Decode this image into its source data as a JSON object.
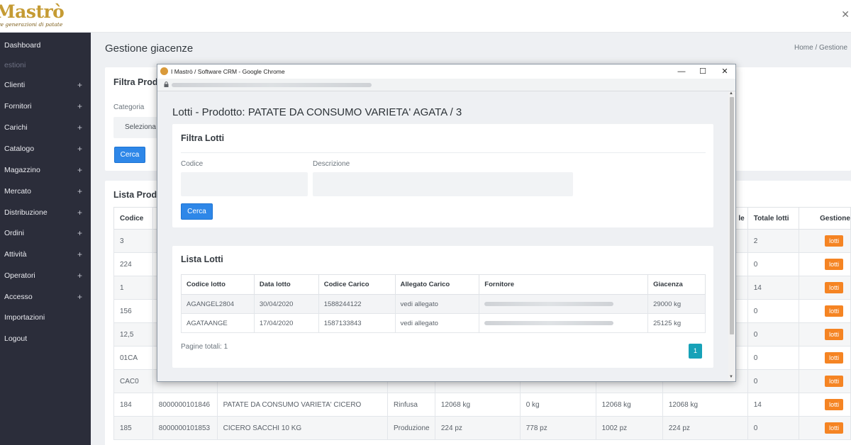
{
  "brand": {
    "name": "Mastrò",
    "tagline": "tre generazioni di patate"
  },
  "topbar": {
    "close_glyph": "✕"
  },
  "sidebar": {
    "items": [
      {
        "label": "Dashboard",
        "expandable": false
      },
      {
        "label": "estioni",
        "section": true
      },
      {
        "label": "Clienti",
        "expandable": true
      },
      {
        "label": "Fornitori",
        "expandable": true
      },
      {
        "label": "Carichi",
        "expandable": true
      },
      {
        "label": "Catalogo",
        "expandable": true
      },
      {
        "label": "Magazzino",
        "expandable": true
      },
      {
        "label": "Mercato",
        "expandable": true
      },
      {
        "label": "Distribuzione",
        "expandable": true
      },
      {
        "label": "Ordini",
        "expandable": true
      },
      {
        "label": "Attività",
        "expandable": true
      },
      {
        "label": "Operatori",
        "expandable": true
      },
      {
        "label": "Accesso",
        "expandable": true
      },
      {
        "label": "Importazioni",
        "expandable": false
      },
      {
        "label": "Logout",
        "expandable": false
      }
    ],
    "plus_glyph": "+"
  },
  "page": {
    "title": "Gestione giacenze",
    "breadcrumb": "Home  /  Gestione"
  },
  "filter_card": {
    "title": "Filtra Prod",
    "category_label": "Categoria",
    "category_value": "Seleziona",
    "search_button": "Cerca"
  },
  "list_card": {
    "title": "Lista Prod",
    "columns": [
      "Codice",
      "",
      "",
      "",
      "",
      "",
      "le",
      "Totale lotti",
      "Gestione"
    ],
    "rows": [
      {
        "codice": "3",
        "ean": "",
        "descrizione": "",
        "tipo": "",
        "c4": "",
        "c5": "",
        "c6": "",
        "totale_lotti": "2"
      },
      {
        "codice": "224",
        "ean": "",
        "descrizione": "",
        "tipo": "",
        "c4": "",
        "c5": "",
        "c6": "",
        "totale_lotti": "0"
      },
      {
        "codice": "1",
        "ean": "",
        "descrizione": "",
        "tipo": "",
        "c4": "",
        "c5": "",
        "c6": "",
        "totale_lotti": "14"
      },
      {
        "codice": "156",
        "ean": "",
        "descrizione": "",
        "tipo": "",
        "c4": "",
        "c5": "",
        "c6": "",
        "totale_lotti": "0"
      },
      {
        "codice": "12,5",
        "ean": "",
        "descrizione": "",
        "tipo": "",
        "c4": "",
        "c5": "",
        "c6": "",
        "totale_lotti": "0"
      },
      {
        "codice": "01CA",
        "ean": "",
        "descrizione": "",
        "tipo": "",
        "c4": "",
        "c5": "",
        "c6": "",
        "totale_lotti": "0"
      },
      {
        "codice": "CAC0",
        "ean": "",
        "descrizione": "",
        "tipo": "",
        "c4": "",
        "c5": "",
        "c6": "",
        "totale_lotti": "0"
      },
      {
        "codice": "184",
        "ean": "8000000101846",
        "descrizione": "PATATE DA CONSUMO VARIETA' CICERO",
        "tipo": "Rinfusa",
        "c4": "12068 kg",
        "c5": "0 kg",
        "c6": "12068 kg",
        "c7": "12068 kg",
        "totale_lotti": "14"
      },
      {
        "codice": "185",
        "ean": "8000000101853",
        "descrizione": "CICERO SACCHI 10 KG",
        "tipo": "Produzione",
        "c4": "224 pz",
        "c5": "778 pz",
        "c6": "1002 pz",
        "c7": "224 pz",
        "totale_lotti": "0"
      }
    ],
    "action_label": "lotti"
  },
  "popup": {
    "window_title": "I Mastrò / Software CRM - Google Chrome",
    "controls": {
      "minimize": "—",
      "maximize": "☐",
      "close": "✕"
    },
    "heading": "Lotti - Prodotto: PATATE DA CONSUMO VARIETA' AGATA / 3",
    "filter": {
      "title": "Filtra Lotti",
      "codice_label": "Codice",
      "descrizione_label": "Descrizione",
      "search_button": "Cerca"
    },
    "list": {
      "title": "Lista Lotti",
      "columns": [
        "Codice lotto",
        "Data lotto",
        "Codice Carico",
        "Allegato Carico",
        "Fornitore",
        "Giacenza"
      ],
      "rows": [
        {
          "codice_lotto": "AGANGEL2804",
          "data_lotto": "30/04/2020",
          "codice_carico": "1588244122",
          "allegato": "vedi allegato",
          "giacenza": "29000 kg"
        },
        {
          "codice_lotto": "AGATAANGE",
          "data_lotto": "17/04/2020",
          "codice_carico": "1587133843",
          "allegato": "vedi allegato",
          "giacenza": "25125 kg"
        }
      ],
      "pages_label": "Pagine totali: 1",
      "current_page": "1"
    }
  }
}
